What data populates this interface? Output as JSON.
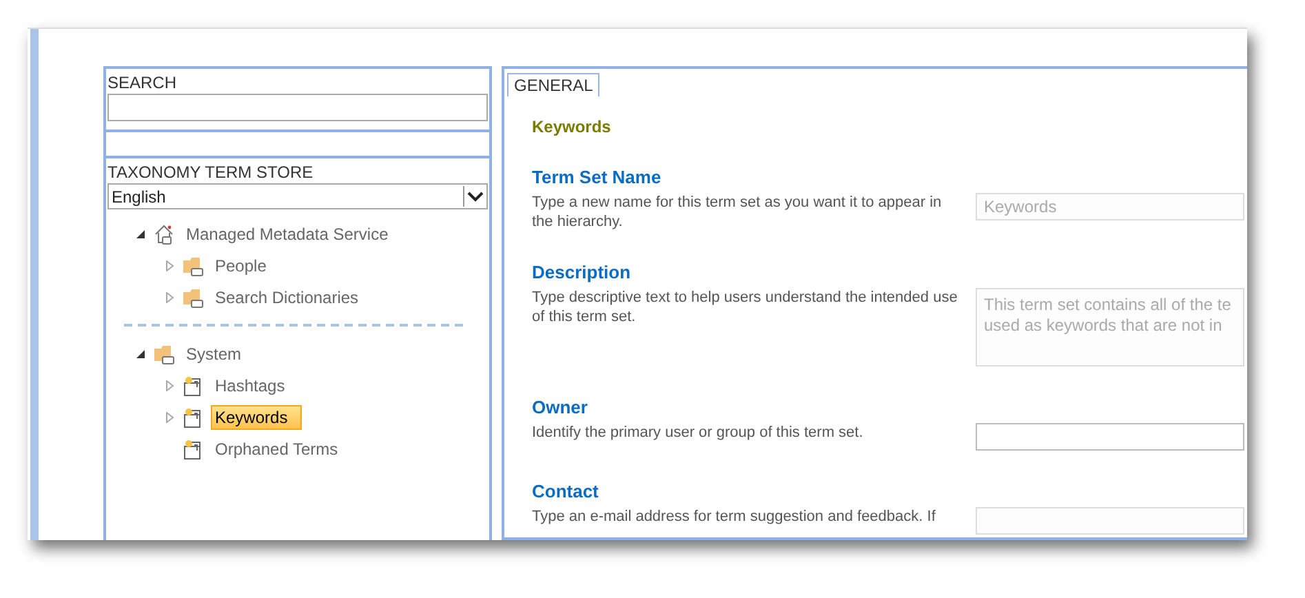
{
  "search": {
    "label": "SEARCH"
  },
  "term_store": {
    "label": "TAXONOMY TERM STORE",
    "language": "English"
  },
  "tree": [
    {
      "label": "Managed Metadata Service",
      "kind": "service",
      "expanded": true,
      "selected": false,
      "children": [
        {
          "label": "People",
          "kind": "group",
          "expanded": false,
          "selected": false
        },
        {
          "label": "Search Dictionaries",
          "kind": "group",
          "expanded": false,
          "selected": false
        }
      ]
    },
    {
      "label": "System",
      "kind": "group",
      "expanded": true,
      "selected": false,
      "separator": true,
      "children": [
        {
          "label": "Hashtags",
          "kind": "termset",
          "expanded": false,
          "selected": false
        },
        {
          "label": "Keywords",
          "kind": "termset",
          "expanded": false,
          "selected": true
        },
        {
          "label": "Orphaned Terms",
          "kind": "termset",
          "selected": false
        }
      ]
    }
  ],
  "tabs": [
    {
      "label": "GENERAL",
      "selected": true
    }
  ],
  "title": "Keywords",
  "sections": [
    {
      "heading": "Term Set Name",
      "help": "Type a new name for this term set as you want it to appear in the hierarchy.",
      "kind": "text",
      "disabled": true,
      "value_lines": [
        "Keywords"
      ]
    },
    {
      "heading": "Description",
      "help": "Type descriptive text to help users understand the intended use of this term set.",
      "kind": "textarea",
      "disabled": true,
      "value_lines": [
        "This term set contains all of the te",
        "used as keywords that are not in"
      ]
    },
    {
      "heading": "Owner",
      "help": "Identify the primary user or group of this term set.",
      "kind": "text",
      "disabled": false
    },
    {
      "heading": "Contact",
      "help": "Type an e-mail address for term suggestion and feedback. If",
      "kind": "text",
      "disabled": true
    }
  ]
}
